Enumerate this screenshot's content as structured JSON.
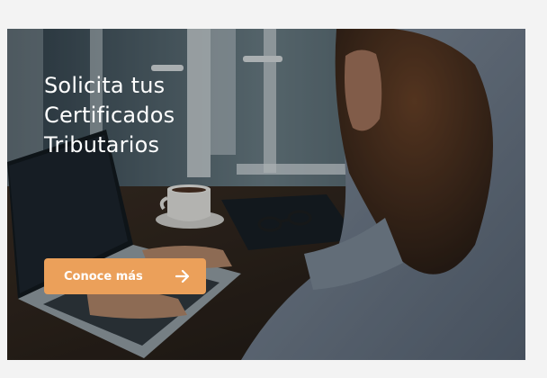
{
  "banner": {
    "headline": "Solicita tus Certificados Tributarios",
    "cta_label": "Conoce más",
    "cta_icon": "arrow-right-icon",
    "accent_color": "#eba05a"
  }
}
